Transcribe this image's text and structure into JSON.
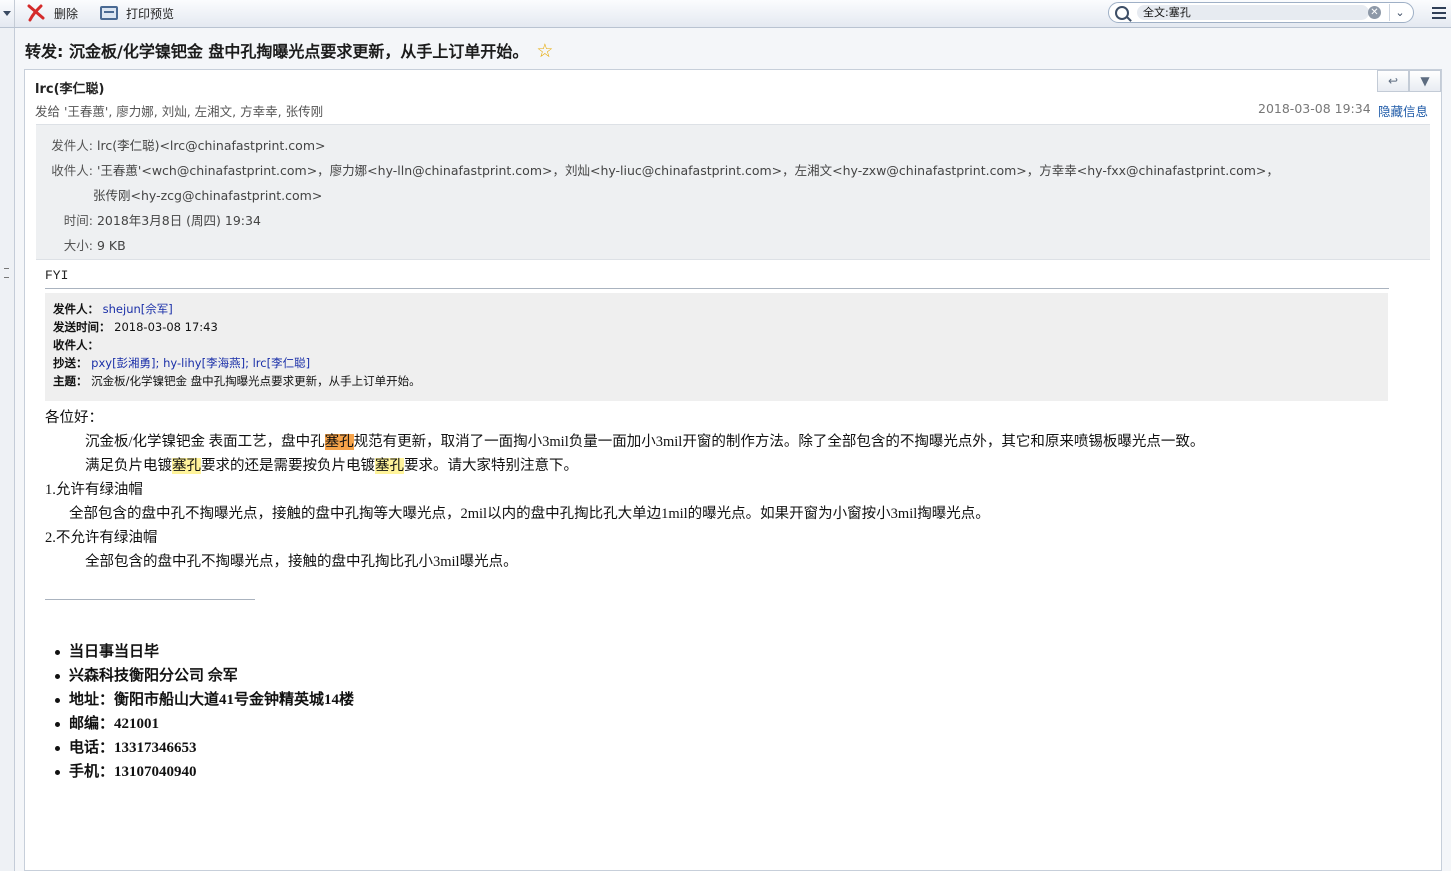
{
  "toolbar": {
    "delete_label": "删除",
    "print_label": "打印预览",
    "search_value": "全文:塞孔",
    "clear_glyph": "✕",
    "options_glyph": "⌄"
  },
  "subject": "转发: 沉金板/化学镍钯金 盘中孔掏曝光点要求更新，从手上订单开始。",
  "message": {
    "from_name": "lrc(李仁聪)",
    "to_summary": "发给 '王春蕙', 廖力娜, 刘灿, 左湘文, 方幸幸, 张传刚",
    "datetime": "2018-03-08 19:34",
    "hide_label": "隐藏信息",
    "reply_glyph": "↩",
    "more_glyph": "▼",
    "details": {
      "from_label": "发件人:",
      "from_value": "lrc(李仁聪)<lrc@chinafastprint.com>",
      "to_label": "收件人:",
      "to_value_1": "'王春蕙'<wch@chinafastprint.com>，廖力娜<hy-lln@chinafastprint.com>，刘灿<hy-liuc@chinafastprint.com>，左湘文<hy-zxw@chinafastprint.com>，方幸幸<hy-fxx@chinafastprint.com>，",
      "to_value_2": "张传刚<hy-zcg@chinafastprint.com>",
      "time_label": "时间:",
      "time_value": "2018年3月8日 (周四) 19:34",
      "size_label": "大小:",
      "size_value": "9 KB"
    }
  },
  "body": {
    "fyi": "FYI",
    "quoted": {
      "from_label": "发件人：",
      "from_value": "shejun[佘军]",
      "sent_label": "发送时间：",
      "sent_value": "2018-03-08 17:43",
      "to_label": "收件人：",
      "cc_label": "抄送：",
      "cc_1": "pxy[彭湘勇]",
      "cc_2": "hy-lihy[李海燕]",
      "cc_3": "lrc[李仁聪]",
      "cc_sep": "; ",
      "subject_label": "主题：",
      "subject_value": "沉金板/化学镍钯金 盘中孔掏曝光点要求更新，从手上订单开始。"
    },
    "greeting": "各位好：",
    "p1_a": "沉金板/化学镍钯金 表面工艺，盘中孔",
    "p1_hl": "塞孔",
    "p1_b": "规范有更新，取消了一面掏小3mil负量一面加小3mil开窗的制作方法。除了全部包含的不掏曝光点外，其它和原来喷锡板曝光点一致。",
    "p2_a": "满足负片电镀",
    "p2_hl1": "塞孔",
    "p2_b": "要求的还是需要按负片电镀",
    "p2_hl2": "塞孔",
    "p2_c": "要求。请大家特别注意下。",
    "h1": "1.允许有绿油帽",
    "p3": "全部包含的盘中孔不掏曝光点，接触的盘中孔掏等大曝光点，2mil以内的盘中孔掏比孔大单边1mil的曝光点。如果开窗为小窗按小3mil掏曝光点。",
    "h2": "2.不允许有绿油帽",
    "p4": "全部包含的盘中孔不掏曝光点，接触的盘中孔掏比孔小3mil曝光点。",
    "signature": [
      "当日事当日毕",
      "兴森科技衡阳分公司 佘军",
      "地址：衡阳市船山大道41号金钟精英城14楼",
      "邮编：421001",
      "电话：13317346653",
      "手机：13107040940"
    ]
  },
  "colors": {
    "current_highlight": "#f6a34a",
    "highlight": "#fff49b",
    "link": "#1f5ba8",
    "star": "#e6a800",
    "delete_icon": "#d42a2a"
  }
}
